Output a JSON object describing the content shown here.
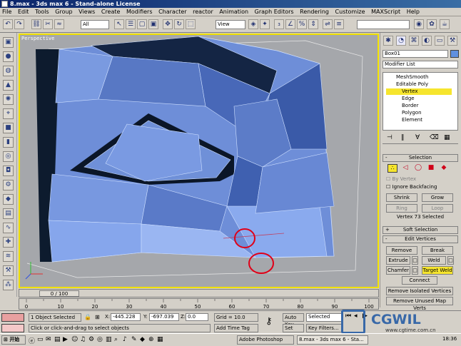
{
  "window": {
    "title": "8.max - 3ds max 6 - Stand-alone License"
  },
  "menu": [
    "File",
    "Edit",
    "Tools",
    "Group",
    "Views",
    "Create",
    "Modifiers",
    "Character",
    "reactor",
    "Animation",
    "Graph Editors",
    "Rendering",
    "Customize",
    "MAXScript",
    "Help"
  ],
  "toolbar": {
    "selection_filter": "All",
    "reference_coord": "View"
  },
  "viewport": {
    "label": "Perspective"
  },
  "timeslider": {
    "frame": "0 / 100"
  },
  "trackbar": {
    "ticks": [
      "0",
      "10",
      "20",
      "30",
      "40",
      "50",
      "60",
      "70",
      "80",
      "90",
      "100"
    ]
  },
  "command_panel": {
    "object_name": "Box01",
    "modifier_list": "Modifier List",
    "stack": [
      "MeshSmooth",
      "Editable Poly",
      "Vertex",
      "Edge",
      "Border",
      "Polygon",
      "Element"
    ],
    "selection": {
      "header": "Selection",
      "by_vertex": "By Vertex",
      "ignore_backfacing": "Ignore Backfacing",
      "shrink": "Shrink",
      "grow": "Grow",
      "ring": "Ring",
      "loop": "Loop",
      "status": "Vertex 73 Selected"
    },
    "soft_selection": {
      "header": "Soft Selection"
    },
    "edit_vertices": {
      "header": "Edit Vertices",
      "remove": "Remove",
      "break": "Break",
      "extrude": "Extrude",
      "weld": "Weld",
      "chamfer": "Chamfer",
      "target_weld": "Target Weld",
      "connect": "Connect",
      "remove_isolated": "Remove Isolated Vertices",
      "remove_unused": "Remove Unused Map Verts"
    }
  },
  "status": {
    "selected": "1 Object Selected",
    "prompt": "Click or click-and-drag to select objects",
    "x_label": "X:",
    "x_value": "-445.228",
    "y_label": "Y:",
    "y_value": "-697.039",
    "z_label": "Z:",
    "z_value": "0.0",
    "grid": "Grid = 10.0",
    "add_time_tag": "Add Time Tag",
    "auto_key": "Auto Key",
    "selected_dropdown": "Selected",
    "set_key": "Set Key",
    "key_filters": "Key Filters..."
  },
  "taskbar": {
    "start": "开始",
    "tasks": [
      "Adobe Photoshop",
      "8.max - 3ds max 6 - Sta..."
    ],
    "clock": "18:36"
  },
  "watermark": {
    "brand": "CGWIL",
    "url": "www.cgtime.com.cn"
  }
}
